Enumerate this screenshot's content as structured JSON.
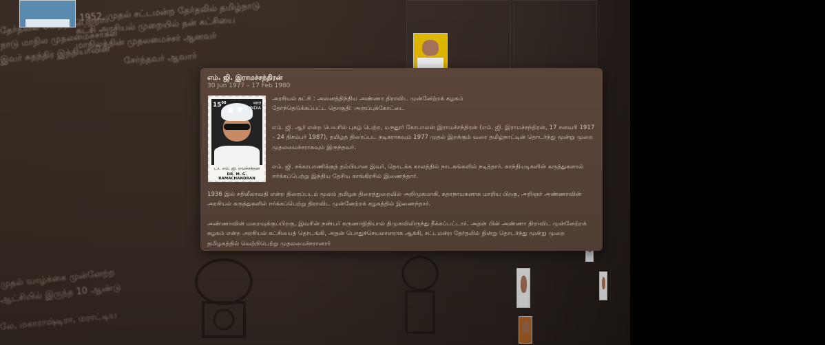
{
  "popup": {
    "name": "எம். ஜி. இராமச்சந்திரன்",
    "date_range": "30 Jun 1977 – 17 Feb 1980",
    "party_line": "அரசியல் கட்சி : அனைத்திந்திய அண்ணா திராவிட முன்னேற்றக் கழகம்",
    "constituency_line": "தேர்ந்தெடுக்கப்பட்ட தொகுதி: அருப்புக்கோட்டை",
    "stamp": {
      "value": "15",
      "value_small": "00",
      "country_tamil": "भारत",
      "country": "INDIA",
      "name_tamil": "டா. எம். ஜி. ராமச்சந்தன",
      "name_english": "DR. M. G. RAMACHANDRAN"
    },
    "bio_para1": "எம். ஜி. ஆர் என்ற பெயரில் புகழ் பெற்ற, மருதூர் கோபாலன் இராமச்சந்திரன் (எம். ஜி. இராமச்சந்திரன், 17 சனவரி 1917 – 24 திசம்பர் 1987), தமிழ்த் திரைப்பட நடிகராகவும் 1977 முதல் இறக்கும் வரை தமிழ்நாட்டின் தொடர்ந்து மூன்று முறை முதலமைச்சராகவும் இருந்தவர்.",
    "bio_para2": "எம். ஜி. சக்கரபாணிக்குத் தம்பியான இவர், தொடக்க காலத்தில் நாடகங்களில் நடித்தார். காந்தியடிகளின் கருத்துகளால் ஈர்க்கப்பெற்று இந்திய தேசிய காங்கிரசில் இணைந்தார்.",
    "bio_para3": "1936 இல் சதிலீலாவதி என்ற திரைப்படம் மூலம் தமிழக திரைத்துறையில் அறிமுகமாகி, கதாநாயகனாக மாறிய பிறகு, அறிஞர் அண்ணாவின் அரசியல் கருத்துகளில் ஈர்க்கப்பெற்று திராவிட முன்னேற்றக் கழகத்தில் இணைந்தார்.",
    "bio_para4": "அண்ணாவின் மறைவுக்குப்பிறகு, இவரின் நண்பர் கருணாநிதியால் திமுகவிலிருந்து நீக்கப்பட்டார். அதன் பின் அண்ணா திராவிட முன்னேற்றக் கழகம் என்ற அரசியல் கட்சியைத் தொடங்கி, அதன் பொதுச்செயலாளராக ஆக்கி, சட்டமன்ற தேர்தலில் நின்று தொடர்ந்து மூன்று முறை தமிழகத்தில் வெற்றிபெற்று முதலமைச்சரானார்"
  },
  "background_text": {
    "line1": "1952, முதல் சட்டமன்ற தேர்தலில் தமிழ்நாடு",
    "line2": "கட்சி அரசியல் முறையில் தன் கட்சியை",
    "line3": "மாநிலத்தின் முதலமைச்சர் ஆனவர்",
    "line4": "தேர்தலில் வெற்றி பெற்றார்",
    "line5": "நாடு மாநில முதலமைச்சர்கள்",
    "line6": "இவர் சுதந்திர இந்தியாவின்",
    "line7": "சேர்ந்தவர் ஆவார்",
    "bottom1": "முதல் வாழ்க்கை முன்னேற்ற",
    "bottom2": "ஆட்சியில் இருந்த 10 ஆண்டு",
    "bottom3": "லே, மகாராஷ்டிரா, மராட்டிய"
  }
}
